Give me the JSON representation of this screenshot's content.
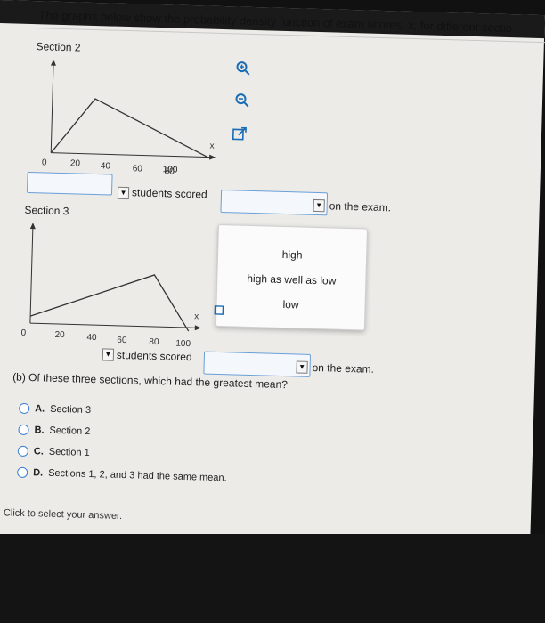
{
  "question": {
    "title": "The graphs below show the probability density function of exam scores, x, for different sectio"
  },
  "section2": {
    "label": "Section 2",
    "ticks": [
      "0",
      "20",
      "40",
      "60",
      "80",
      "100"
    ],
    "axis_var": "x"
  },
  "section3": {
    "label": "Section 3",
    "ticks": [
      "0",
      "20",
      "40",
      "60",
      "80",
      "100"
    ],
    "axis_var": "x"
  },
  "row1": {
    "students_scored": "students scored",
    "on_the_exam": "on the exam."
  },
  "row2": {
    "students_scored": "students scored",
    "on_the_exam": "on the exam."
  },
  "dropdown": {
    "options": [
      "high",
      "high as well as low",
      "low"
    ]
  },
  "part_b": {
    "question": "(b) Of these three sections, which had the greatest mean?",
    "options": [
      {
        "letter": "A.",
        "label": "Section 3"
      },
      {
        "letter": "B.",
        "label": "Section 2"
      },
      {
        "letter": "C.",
        "label": "Section 1"
      },
      {
        "letter": "D.",
        "label": "Sections 1, 2, and 3 had the same mean."
      }
    ]
  },
  "footer": {
    "hint": "Click to select your answer."
  },
  "icons": {
    "zoom_in": "zoom-in-icon",
    "zoom_out": "zoom-out-icon",
    "popout": "external-link-icon"
  }
}
